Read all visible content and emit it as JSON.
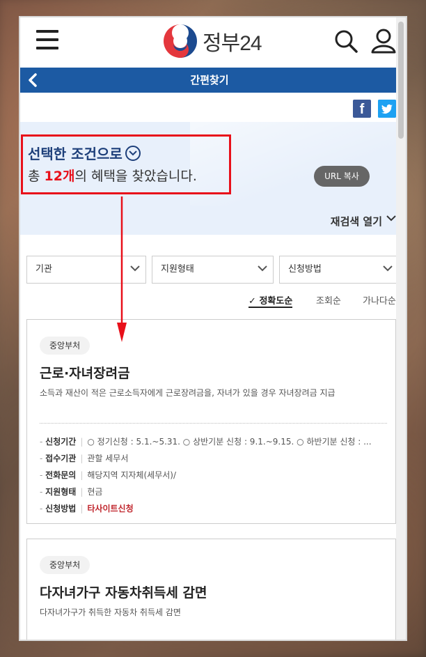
{
  "header": {
    "logo_text": "정부24",
    "icons": {
      "menu": "hamburger-icon",
      "search": "search-icon",
      "user": "user-icon",
      "logo": "taegeuk-logo"
    }
  },
  "navbar": {
    "title": "간편찾기",
    "back_icon": "chevron-left-icon",
    "color": "#1c5aa3"
  },
  "share": {
    "facebook_label": "f",
    "icons": [
      "facebook-icon",
      "twitter-icon"
    ]
  },
  "result": {
    "condition_title": "선택한 조건으로",
    "text_prefix": "총 ",
    "count": "12개",
    "text_suffix": "의 혜택을 찾았습니다.",
    "url_button": "URL 복사"
  },
  "research": {
    "label": "재검색 열기"
  },
  "filters": [
    {
      "label": "기관"
    },
    {
      "label": "지원형태"
    },
    {
      "label": "신청방법"
    }
  ],
  "sorts": [
    {
      "label": "정확도순",
      "active": true,
      "check": "✓"
    },
    {
      "label": "조회순",
      "active": false
    },
    {
      "label": "가나다순",
      "active": false
    }
  ],
  "cards": [
    {
      "badge": "중앙부처",
      "title": "근로·자녀장려금",
      "desc": "소득과 재산이 적은 근로소득자에게 근로장려금을, 자녀가 있을 경우 자녀장려금 지급",
      "info": [
        {
          "label": "신청기간",
          "value": "○ 정기신청 : 5.1.~5.31. ○ 상반기분 신청 : 9.1.~9.15. ○ 하반기분 신청 : ..."
        },
        {
          "label": "접수기관",
          "value": "관할 세무서"
        },
        {
          "label": "전화문의",
          "value": "해당지역 지자체(세무서)/"
        },
        {
          "label": "지원형태",
          "value": "현금"
        },
        {
          "label": "신청방법",
          "value": "타사이트신청"
        }
      ]
    },
    {
      "badge": "중앙부처",
      "title": "다자녀가구 자동차취득세 감면",
      "desc": "다자녀가구가 취득한 자동차 취득세 감면"
    }
  ],
  "annotation": {
    "box_color": "#e8101a",
    "arrow_color": "#e8101a"
  }
}
